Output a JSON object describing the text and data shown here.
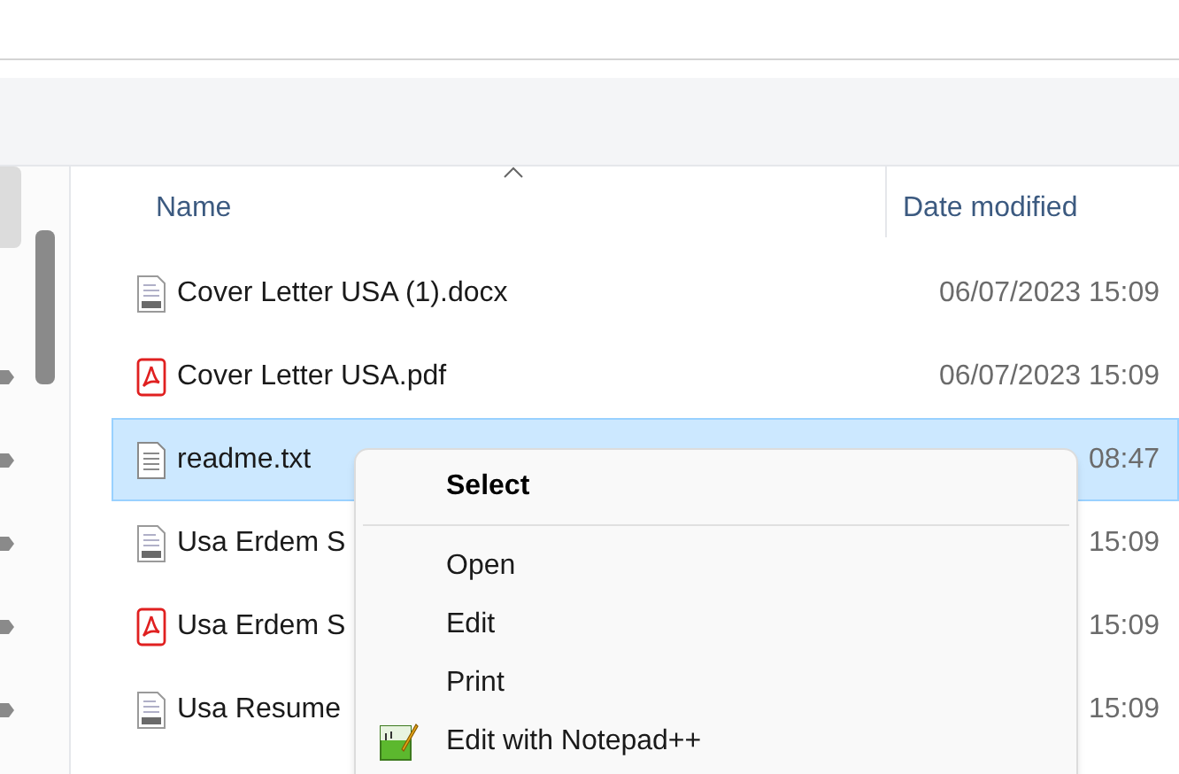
{
  "columns": [
    {
      "label": "Name",
      "sorted": true
    },
    {
      "label": "Date modified"
    }
  ],
  "rows": [
    {
      "name": "Cover Letter USA (1).docx",
      "date": "06/07/2023 15:09",
      "kind": "docx",
      "selected": false
    },
    {
      "name": "Cover Letter USA.pdf",
      "date": "06/07/2023 15:09",
      "kind": "pdf",
      "selected": false
    },
    {
      "name": "readme.txt",
      "date": "08:47",
      "kind": "txt",
      "selected": true
    },
    {
      "name": "Usa Erdem S",
      "date": "15:09",
      "kind": "docx",
      "selected": false
    },
    {
      "name": "Usa Erdem S",
      "date": "15:09",
      "kind": "pdf",
      "selected": false
    },
    {
      "name": "Usa Resume",
      "date": "15:09",
      "kind": "docx",
      "selected": false
    }
  ],
  "context_menu": {
    "items": [
      {
        "label": "Select",
        "kind": "header"
      },
      {
        "label": "Open",
        "kind": "plain"
      },
      {
        "label": "Edit",
        "kind": "plain"
      },
      {
        "label": "Print",
        "kind": "plain"
      },
      {
        "label": "Edit with Notepad++",
        "kind": "notepad"
      }
    ]
  }
}
